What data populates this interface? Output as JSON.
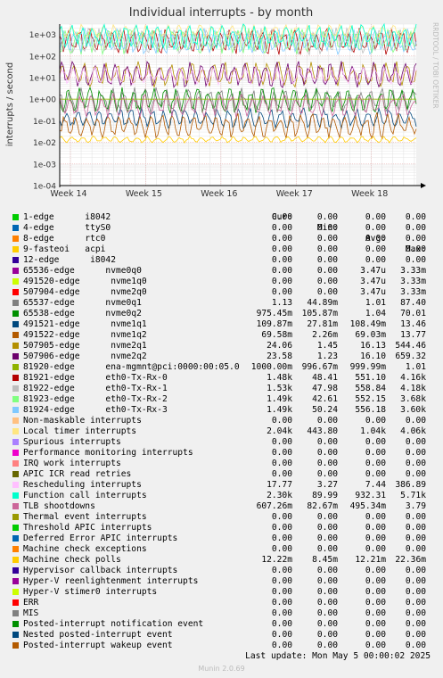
{
  "chart_data": {
    "type": "line",
    "title": "Individual interrupts - by month",
    "ylabel": "interrupts / second",
    "yscale": "log",
    "ylim": [
      0.0001,
      3000
    ],
    "yticks": [
      "1e-04",
      "1e-03",
      "1e-02",
      "1e-01",
      "1e+00",
      "1e+01",
      "1e+02",
      "1e+03"
    ],
    "xticks": [
      "Week 14",
      "Week 15",
      "Week 16",
      "Week 17",
      "Week 18"
    ],
    "grid": true,
    "watermark": "RRDTOOL / TOBI OETIKER",
    "columns": [
      "Cur:",
      "Min:",
      "Avg:",
      "Max:"
    ],
    "series": [
      {
        "name": "1-edge      i8042",
        "color": "#00cc00",
        "cur": "0.00",
        "min": "0.00",
        "avg": "0.00",
        "max": "0.00"
      },
      {
        "name": "4-edge      ttyS0",
        "color": "#0066b3",
        "cur": "0.00",
        "min": "0.00",
        "avg": "0.00",
        "max": "0.00"
      },
      {
        "name": "8-edge      rtc0",
        "color": "#ff8000",
        "cur": "0.00",
        "min": "0.00",
        "avg": "0.00",
        "max": "0.00"
      },
      {
        "name": "9-fasteoi   acpi",
        "color": "#ffcc00",
        "cur": "0.00",
        "min": "0.00",
        "avg": "0.00",
        "max": "0.00"
      },
      {
        "name": "12-edge      i8042",
        "color": "#330099",
        "cur": "0.00",
        "min": "0.00",
        "avg": "0.00",
        "max": "0.00"
      },
      {
        "name": "65536-edge      nvme0q0",
        "color": "#990099",
        "cur": "0.00",
        "min": "0.00",
        "avg": "3.47u",
        "max": "3.33m"
      },
      {
        "name": "491520-edge      nvme1q0",
        "color": "#ccff00",
        "cur": "0.00",
        "min": "0.00",
        "avg": "3.47u",
        "max": "3.33m"
      },
      {
        "name": "507904-edge      nvme2q0",
        "color": "#ff0000",
        "cur": "0.00",
        "min": "0.00",
        "avg": "3.47u",
        "max": "3.33m"
      },
      {
        "name": "65537-edge      nvme0q1",
        "color": "#808080",
        "cur": "1.13",
        "min": "44.89m",
        "avg": "1.01",
        "max": "87.40"
      },
      {
        "name": "65538-edge      nvme0q2",
        "color": "#008f00",
        "cur": "975.45m",
        "min": "105.87m",
        "avg": "1.04",
        "max": "70.01"
      },
      {
        "name": "491521-edge      nvme1q1",
        "color": "#00487d",
        "cur": "109.87m",
        "min": "27.81m",
        "avg": "108.49m",
        "max": "13.46"
      },
      {
        "name": "491522-edge      nvme1q2",
        "color": "#b35a00",
        "cur": "69.58m",
        "min": "2.26m",
        "avg": "69.03m",
        "max": "13.77"
      },
      {
        "name": "507905-edge      nvme2q1",
        "color": "#b38f00",
        "cur": "24.06",
        "min": "1.45",
        "avg": "16.13",
        "max": "544.46"
      },
      {
        "name": "507906-edge      nvme2q2",
        "color": "#6b006b",
        "cur": "23.58",
        "min": "1.23",
        "avg": "16.10",
        "max": "659.32"
      },
      {
        "name": "81920-edge      ena-mgmnt@pci:0000:00:05.0",
        "color": "#8fb300",
        "cur": "1000.00m",
        "min": "996.67m",
        "avg": "999.99m",
        "max": "1.01"
      },
      {
        "name": "81921-edge      eth0-Tx-Rx-0",
        "color": "#b30000",
        "cur": "1.48k",
        "min": "48.41",
        "avg": "551.10",
        "max": "4.16k"
      },
      {
        "name": "81922-edge      eth0-Tx-Rx-1",
        "color": "#bebebe",
        "cur": "1.53k",
        "min": "47.98",
        "avg": "558.84",
        "max": "4.18k"
      },
      {
        "name": "81923-edge      eth0-Tx-Rx-2",
        "color": "#80ff80",
        "cur": "1.49k",
        "min": "42.61",
        "avg": "552.15",
        "max": "3.68k"
      },
      {
        "name": "81924-edge      eth0-Tx-Rx-3",
        "color": "#80c9ff",
        "cur": "1.49k",
        "min": "50.24",
        "avg": "556.18",
        "max": "3.60k"
      },
      {
        "name": "Non-maskable interrupts",
        "color": "#ffc080",
        "cur": "0.00",
        "min": "0.00",
        "avg": "0.00",
        "max": "0.00"
      },
      {
        "name": "Local timer interrupts",
        "color": "#ffe680",
        "cur": "2.04k",
        "min": "443.80",
        "avg": "1.04k",
        "max": "4.06k"
      },
      {
        "name": "Spurious interrupts",
        "color": "#aa80ff",
        "cur": "0.00",
        "min": "0.00",
        "avg": "0.00",
        "max": "0.00"
      },
      {
        "name": "Performance monitoring interrupts",
        "color": "#ee00cc",
        "cur": "0.00",
        "min": "0.00",
        "avg": "0.00",
        "max": "0.00"
      },
      {
        "name": "IRQ work interrupts",
        "color": "#ff8080",
        "cur": "0.00",
        "min": "0.00",
        "avg": "0.00",
        "max": "0.00"
      },
      {
        "name": "APIC ICR read retries",
        "color": "#666600",
        "cur": "0.00",
        "min": "0.00",
        "avg": "0.00",
        "max": "0.00"
      },
      {
        "name": "Rescheduling interrupts",
        "color": "#ffbfff",
        "cur": "17.77",
        "min": "3.27",
        "avg": "7.44",
        "max": "386.89"
      },
      {
        "name": "Function call interrupts",
        "color": "#00ffcc",
        "cur": "2.30k",
        "min": "89.99",
        "avg": "932.31",
        "max": "5.71k"
      },
      {
        "name": "TLB shootdowns",
        "color": "#cc6699",
        "cur": "607.26m",
        "min": "82.67m",
        "avg": "495.34m",
        "max": "3.79"
      },
      {
        "name": "Thermal event interrupts",
        "color": "#999900",
        "cur": "0.00",
        "min": "0.00",
        "avg": "0.00",
        "max": "0.00"
      },
      {
        "name": "Threshold APIC interrupts",
        "color": "#00cc00",
        "cur": "0.00",
        "min": "0.00",
        "avg": "0.00",
        "max": "0.00"
      },
      {
        "name": "Deferred Error APIC interrupts",
        "color": "#0066b3",
        "cur": "0.00",
        "min": "0.00",
        "avg": "0.00",
        "max": "0.00"
      },
      {
        "name": "Machine check exceptions",
        "color": "#ff8000",
        "cur": "0.00",
        "min": "0.00",
        "avg": "0.00",
        "max": "0.00"
      },
      {
        "name": "Machine check polls",
        "color": "#ffcc00",
        "cur": "12.22m",
        "min": "8.45m",
        "avg": "12.21m",
        "max": "22.36m"
      },
      {
        "name": "Hypervisor callback interrupts",
        "color": "#330099",
        "cur": "0.00",
        "min": "0.00",
        "avg": "0.00",
        "max": "0.00"
      },
      {
        "name": "Hyper-V reenlightenment interrupts",
        "color": "#990099",
        "cur": "0.00",
        "min": "0.00",
        "avg": "0.00",
        "max": "0.00"
      },
      {
        "name": "Hyper-V stimer0 interrupts",
        "color": "#ccff00",
        "cur": "0.00",
        "min": "0.00",
        "avg": "0.00",
        "max": "0.00"
      },
      {
        "name": "ERR",
        "color": "#ff0000",
        "cur": "0.00",
        "min": "0.00",
        "avg": "0.00",
        "max": "0.00"
      },
      {
        "name": "MIS",
        "color": "#808080",
        "cur": "0.00",
        "min": "0.00",
        "avg": "0.00",
        "max": "0.00"
      },
      {
        "name": "Posted-interrupt notification event",
        "color": "#008f00",
        "cur": "0.00",
        "min": "0.00",
        "avg": "0.00",
        "max": "0.00"
      },
      {
        "name": "Nested posted-interrupt event",
        "color": "#00487d",
        "cur": "0.00",
        "min": "0.00",
        "avg": "0.00",
        "max": "0.00"
      },
      {
        "name": "Posted-interrupt wakeup event",
        "color": "#b35a00",
        "cur": "0.00",
        "min": "0.00",
        "avg": "0.00",
        "max": "0.00"
      }
    ]
  },
  "footer": {
    "last_update": "Last update: Mon May  5 00:00:02 2025",
    "munin": "Munin 2.0.69"
  }
}
